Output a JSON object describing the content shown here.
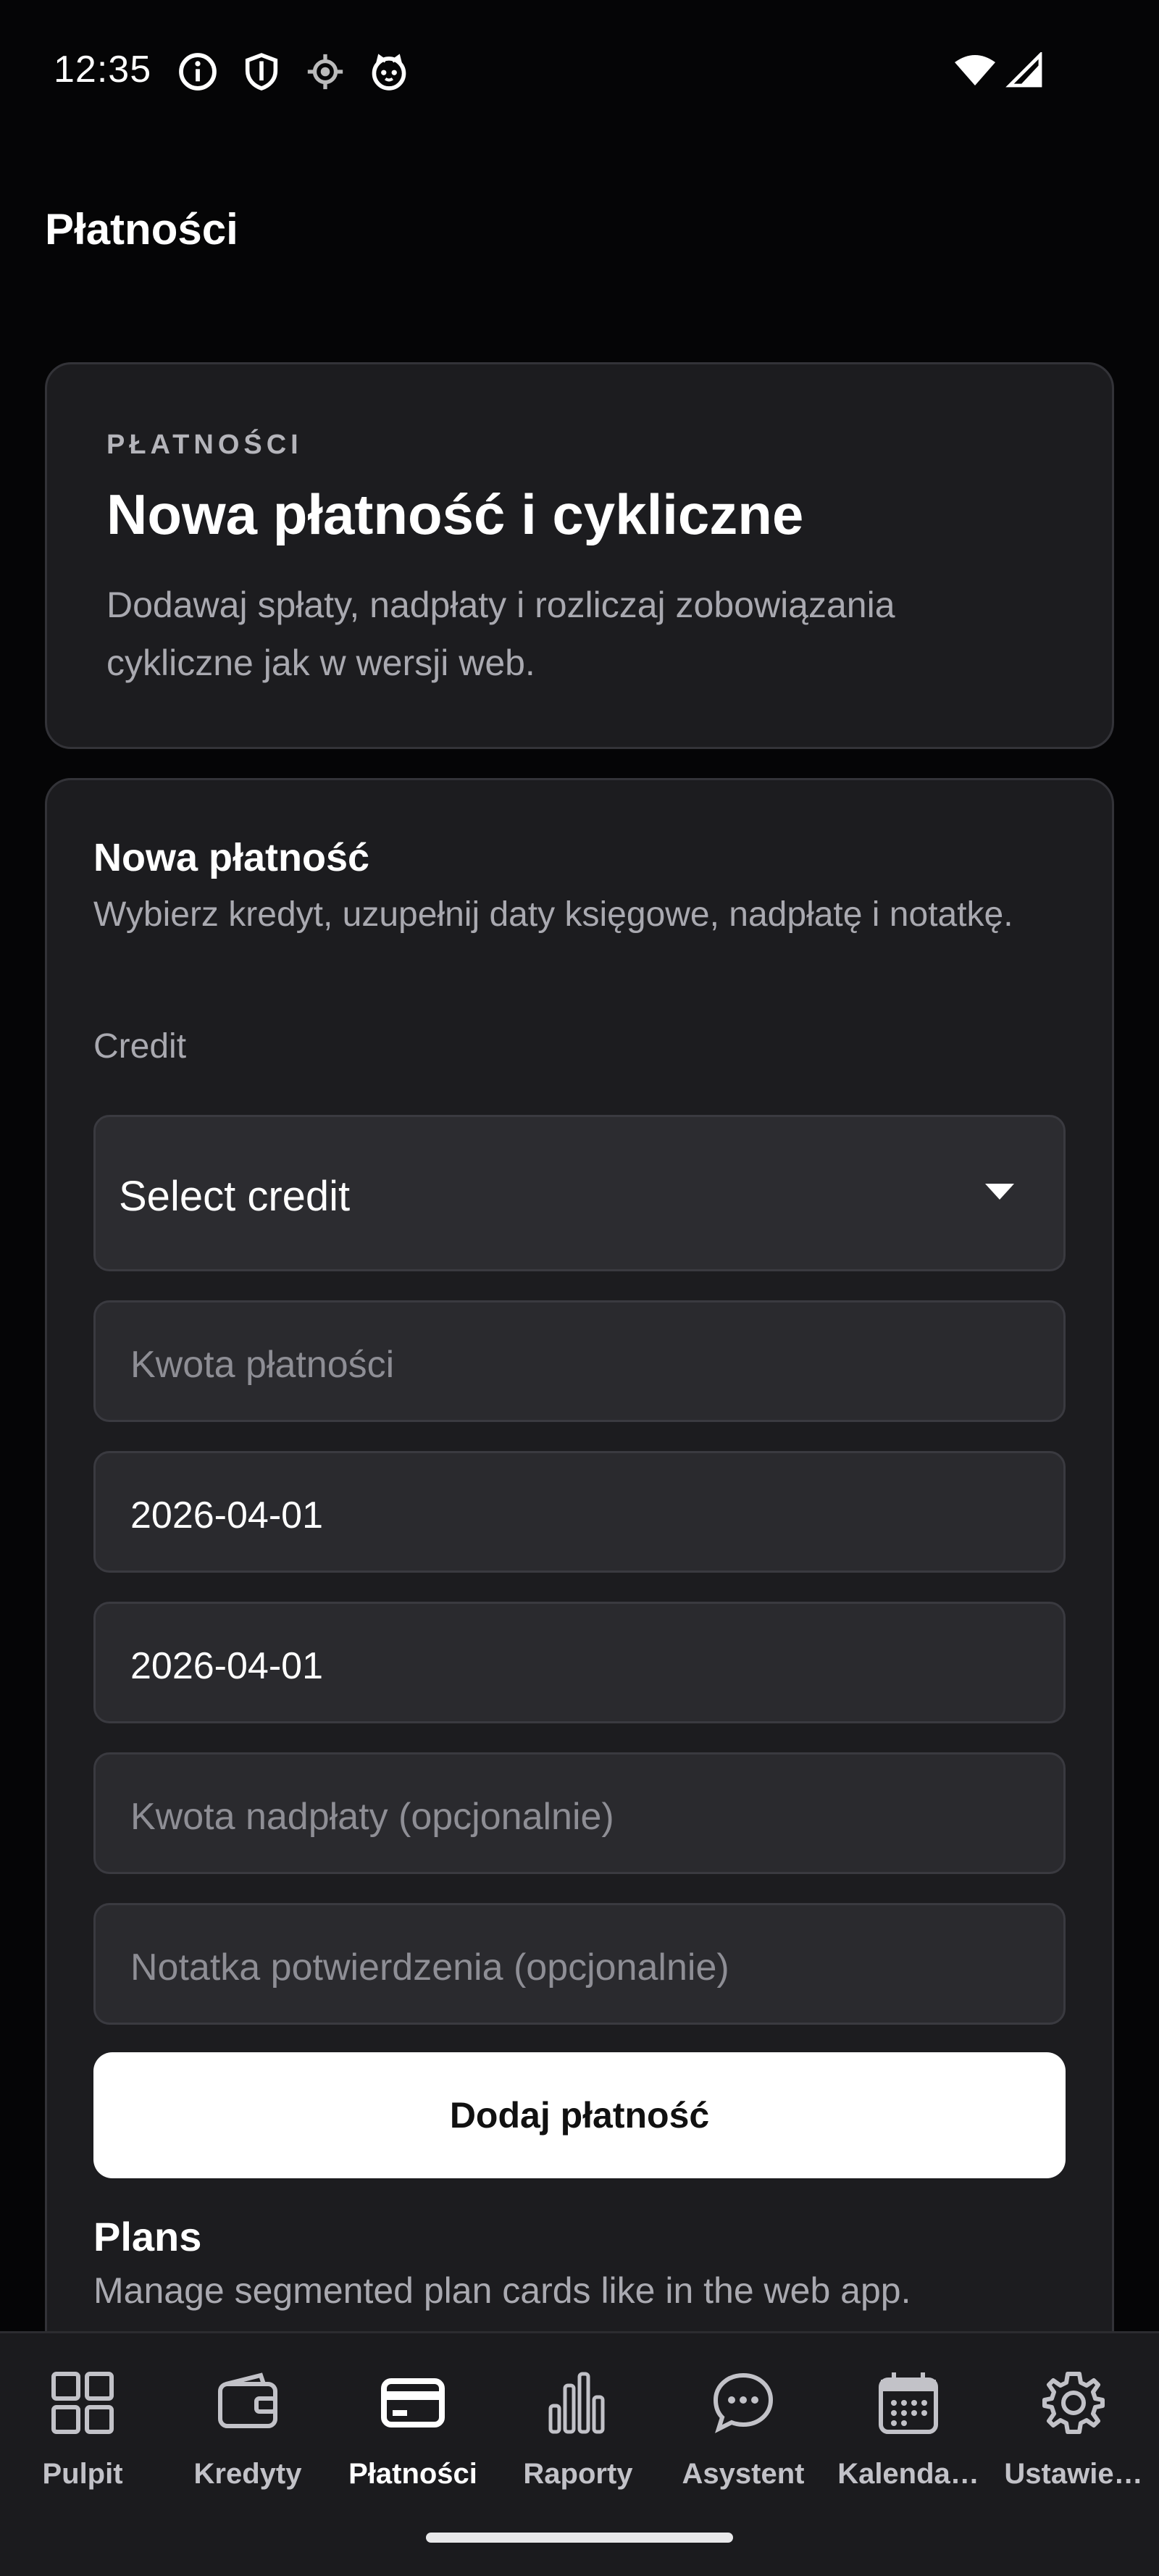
{
  "status_bar": {
    "time": "12:35",
    "icons": [
      "info-icon",
      "shield-icon",
      "location-icon",
      "cat-icon"
    ],
    "right_icons": [
      "wifi-icon",
      "cellular-signal-icon"
    ]
  },
  "header": {
    "title": "Płatności"
  },
  "hero": {
    "eyebrow": "PŁATNOŚCI",
    "title": "Nowa płatność i cykliczne",
    "description": "Dodawaj spłaty, nadpłaty i rozliczaj zobowiązania cykliczne jak w wersji web."
  },
  "form": {
    "title": "Nowa płatność",
    "description": "Wybierz kredyt, uzupełnij daty księgowe, nadpłatę i notatkę.",
    "credit_label": "Credit",
    "credit_select": {
      "value": "Select credit"
    },
    "amount": {
      "placeholder": "Kwota płatności",
      "value": ""
    },
    "date_1": {
      "value": "2026-04-01"
    },
    "date_2": {
      "value": "2026-04-01"
    },
    "overpayment": {
      "placeholder": "Kwota nadpłaty (opcjonalnie)",
      "value": ""
    },
    "note": {
      "placeholder": "Notatka potwierdzenia (opcjonalnie)",
      "value": ""
    },
    "submit_label": "Dodaj płatność"
  },
  "plans": {
    "title": "Plans",
    "description": "Manage segmented plan cards like in the web app."
  },
  "nav": {
    "items": [
      {
        "label": "Pulpit",
        "icon": "grid-icon",
        "active": false
      },
      {
        "label": "Kredyty",
        "icon": "wallet-icon",
        "active": false
      },
      {
        "label": "Płatności",
        "icon": "credit-card-icon",
        "active": true
      },
      {
        "label": "Raporty",
        "icon": "bar-chart-icon",
        "active": false
      },
      {
        "label": "Asystent",
        "icon": "chat-bubble-icon",
        "active": false
      },
      {
        "label": "Kalenda…",
        "icon": "calendar-icon",
        "active": false
      },
      {
        "label": "Ustawie…",
        "icon": "gear-icon",
        "active": false
      }
    ]
  },
  "colors": {
    "background": "#050506",
    "card": "#1c1c1f",
    "field": "#2a2a2e",
    "primary_button": "#ffffff",
    "muted_text": "#a9a9b0"
  }
}
